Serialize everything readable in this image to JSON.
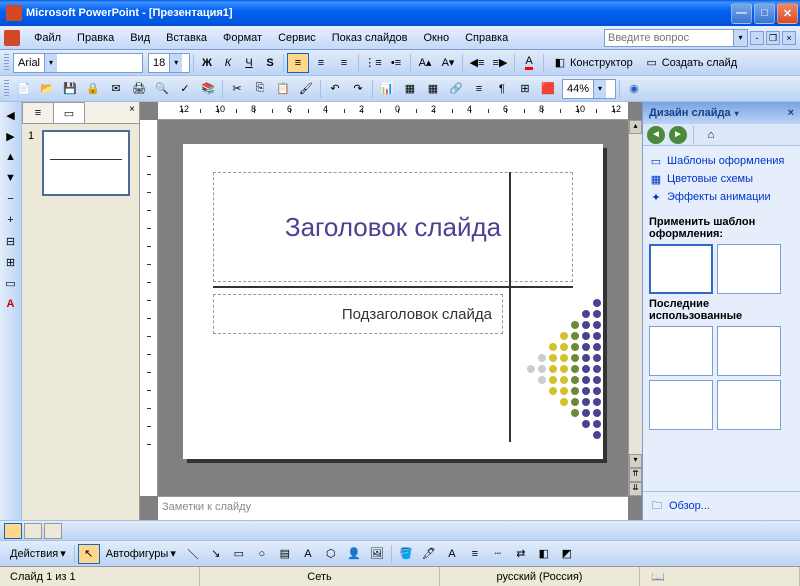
{
  "titlebar": {
    "title": "Microsoft PowerPoint - [Презентация1]"
  },
  "menu": {
    "file": "Файл",
    "edit": "Правка",
    "view": "Вид",
    "insert": "Вставка",
    "format": "Формат",
    "tools": "Сервис",
    "slideshow": "Показ слайдов",
    "window": "Окно",
    "help": "Справка",
    "askbox": "Введите вопрос"
  },
  "format_toolbar": {
    "font": "Arial",
    "size": "18",
    "bold": "Ж",
    "italic": "К",
    "underline": "Ч",
    "shadow": "S",
    "designer": "Конструктор",
    "new_slide": "Создать слайд"
  },
  "standard_toolbar": {
    "zoom": "44%"
  },
  "thumb": {
    "num": "1"
  },
  "slide": {
    "title": "Заголовок слайда",
    "subtitle": "Подзаголовок слайда"
  },
  "notes": {
    "placeholder": "Заметки к слайду"
  },
  "taskpane": {
    "title": "Дизайн слайда",
    "link_templates": "Шаблоны оформления",
    "link_colors": "Цветовые схемы",
    "link_anim": "Эффекты анимации",
    "apply": "Применить шаблон оформления:",
    "recent": "Последние использованные",
    "browse": "Обзор..."
  },
  "drawbar": {
    "actions": "Действия",
    "autoshapes": "Автофигуры"
  },
  "status": {
    "slide": "Слайд 1 из 1",
    "template": "Сеть",
    "lang": "русский (Россия)"
  }
}
